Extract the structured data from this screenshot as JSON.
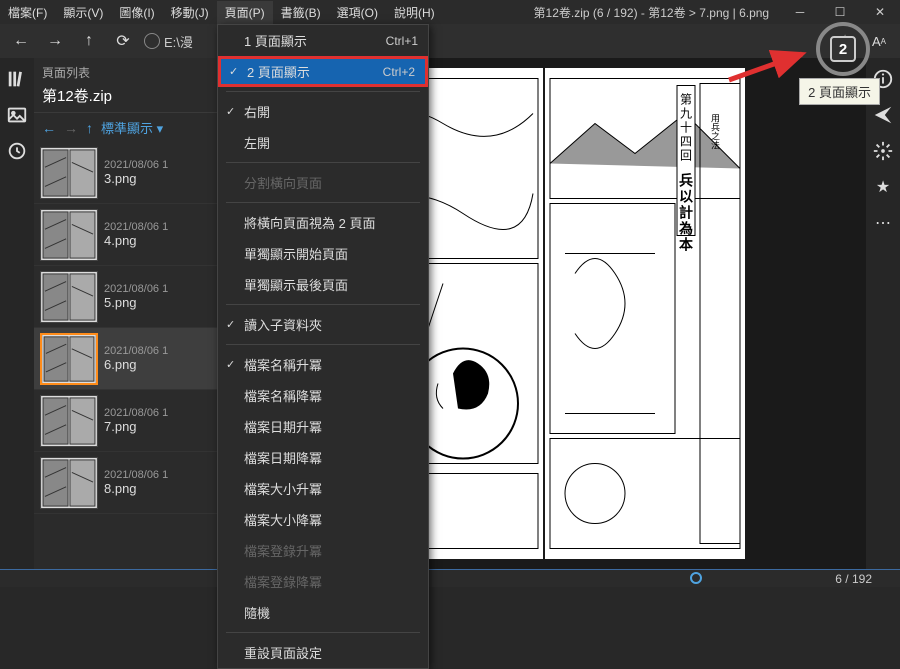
{
  "menubar": {
    "items": [
      "檔案(F)",
      "顯示(V)",
      "圖像(I)",
      "移動(J)",
      "頁面(P)",
      "書籤(B)",
      "選項(O)",
      "說明(H)"
    ],
    "active_index": 4,
    "title": "第12卷.zip (6 / 192) - 第12卷 > 7.png | 6.png"
  },
  "toolbar": {
    "address_label": "E:\\漫"
  },
  "sidebar": {
    "title": "頁面列表",
    "file": "第12卷.zip",
    "view_mode": "標準顯示",
    "thumbs": [
      {
        "date": "2021/08/06 1",
        "name": "3.png"
      },
      {
        "date": "2021/08/06 1",
        "name": "4.png"
      },
      {
        "date": "2021/08/06 1",
        "name": "5.png"
      },
      {
        "date": "2021/08/06 1",
        "name": "6.png"
      },
      {
        "date": "2021/08/06 1",
        "name": "7.png"
      },
      {
        "date": "2021/08/06 1",
        "name": "8.png"
      }
    ],
    "selected_index": 3
  },
  "dropdown": {
    "groups": [
      [
        {
          "label": "1 頁面顯示",
          "shortcut": "Ctrl+1",
          "checked": false
        },
        {
          "label": "2 頁面顯示",
          "shortcut": "Ctrl+2",
          "checked": true,
          "highlighted": true
        }
      ],
      [
        {
          "label": "右開",
          "checked": true
        },
        {
          "label": "左開"
        }
      ],
      [
        {
          "label": "分割橫向頁面",
          "disabled": true
        }
      ],
      [
        {
          "label": "將橫向頁面視為 2 頁面"
        },
        {
          "label": "單獨顯示開始頁面"
        },
        {
          "label": "單獨顯示最後頁面"
        }
      ],
      [
        {
          "label": "讀入子資料夾",
          "checked": true
        }
      ],
      [
        {
          "label": "檔案名稱升冪",
          "checked": true
        },
        {
          "label": "檔案名稱降冪"
        },
        {
          "label": "檔案日期升冪"
        },
        {
          "label": "檔案日期降冪"
        },
        {
          "label": "檔案大小升冪"
        },
        {
          "label": "檔案大小降冪"
        },
        {
          "label": "檔案登錄升冪",
          "disabled": true
        },
        {
          "label": "檔案登錄降冪",
          "disabled": true
        },
        {
          "label": "隨機"
        }
      ],
      [
        {
          "label": "重設頁面設定"
        }
      ]
    ]
  },
  "annotation": {
    "badge": "2",
    "tooltip": "2 頁面顯示"
  },
  "bottom": {
    "counter": "6 / 192"
  }
}
